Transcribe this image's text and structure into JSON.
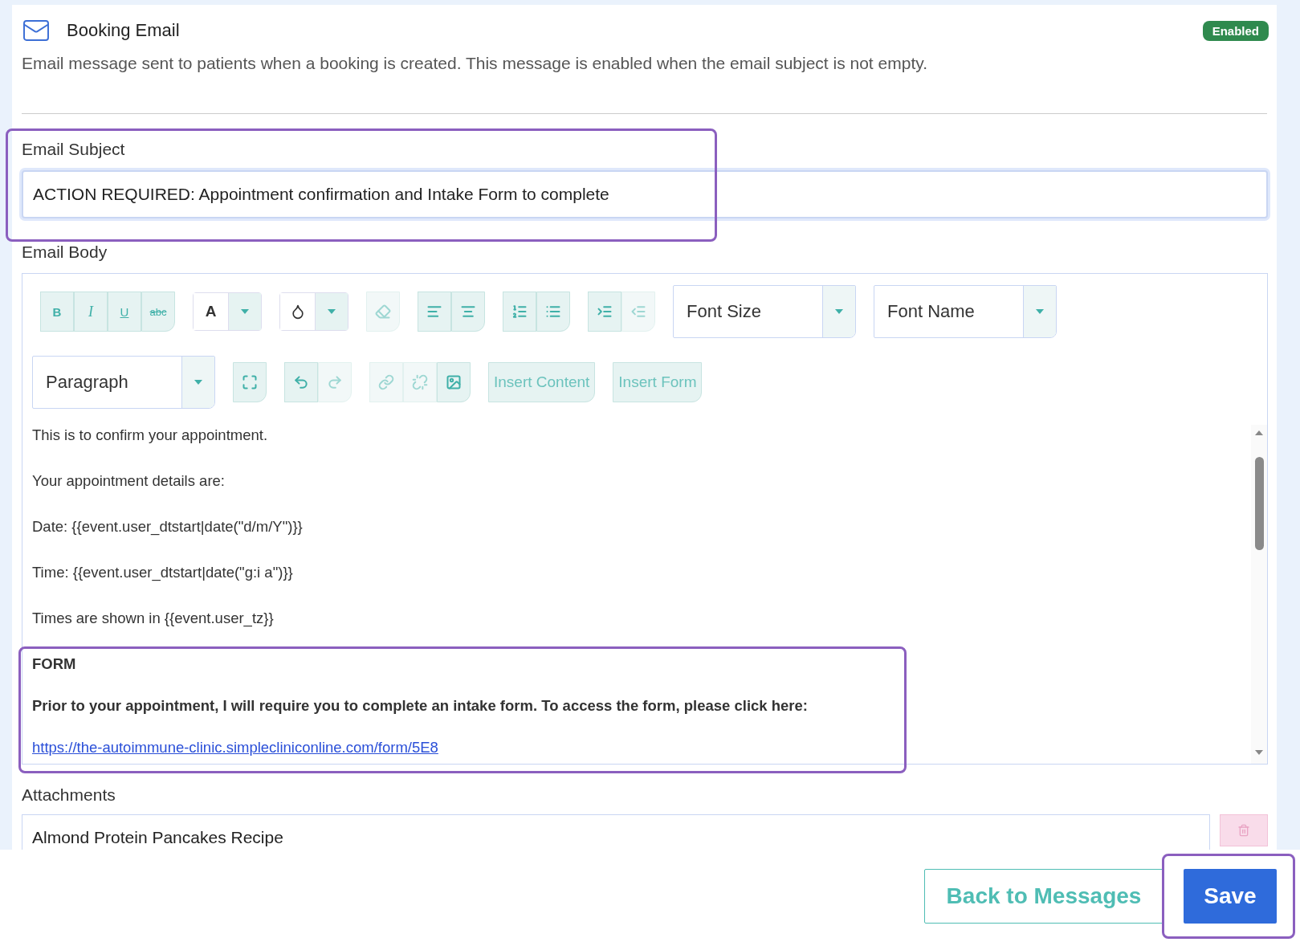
{
  "header": {
    "title": "Booking Email",
    "status": {
      "label": "Enabled",
      "enabled": true
    },
    "description": "Email message sent to patients when a booking is created. This message is enabled when the email subject is not empty."
  },
  "subject": {
    "label": "Email Subject",
    "value": "ACTION REQUIRED: Appointment confirmation and Intake Form to complete"
  },
  "body": {
    "label": "Email Body",
    "toolbar": [
      [
        {
          "kind": "group",
          "items": [
            {
              "label": "B",
              "disabled": false
            },
            {
              "label": "I",
              "disabled": false
            },
            {
              "label": "U",
              "disabled": false
            },
            {
              "label": "abc",
              "disabled": false
            }
          ]
        },
        {
          "kind": "color",
          "label": "A"
        },
        {
          "kind": "color"
        },
        {
          "kind": "group",
          "items": [
            {
              "disabled": true
            }
          ]
        },
        {
          "kind": "group",
          "items": [
            {
              "disabled": false
            },
            {
              "disabled": false
            }
          ]
        },
        {
          "kind": "group",
          "items": [
            {
              "disabled": false
            },
            {
              "disabled": false
            }
          ]
        },
        {
          "kind": "group",
          "items": [
            {
              "disabled": false
            },
            {
              "disabled": true
            }
          ]
        },
        {
          "kind": "select",
          "label": "Font Size"
        },
        {
          "kind": "select",
          "label": "Font Name"
        }
      ],
      [
        {
          "kind": "select",
          "label": "Paragraph"
        },
        {
          "kind": "group",
          "items": [
            {
              "disabled": false
            }
          ]
        },
        {
          "kind": "group",
          "items": [
            {
              "disabled": false
            },
            {
              "disabled": true
            }
          ]
        },
        {
          "kind": "group",
          "items": [
            {
              "disabled": true
            },
            {
              "disabled": true
            },
            {
              "disabled": false
            }
          ]
        },
        {
          "kind": "text_button",
          "label": "Insert Content"
        },
        {
          "kind": "text_button",
          "label": "Insert Form"
        }
      ]
    ],
    "paragraphs": [
      {
        "kind": "text",
        "text": "This is to confirm your appointment."
      },
      {
        "kind": "text",
        "text": "Your appointment details are:"
      },
      {
        "kind": "text",
        "text": "Date: {{event.user_dtstart|date(\"d/m/Y\")}}"
      },
      {
        "kind": "text",
        "text": "Time: {{event.user_dtstart|date(\"g:i a\")}}"
      },
      {
        "kind": "text",
        "text": "Times are shown in  {{event.user_tz}}"
      },
      {
        "kind": "bold",
        "text": "FORM"
      },
      {
        "kind": "bold",
        "text": "Prior to your appointment, I will require you to complete an intake form. To access the form, please click here:"
      },
      {
        "kind": "link",
        "text": "https://the-autoimmune-clinic.simplecliniconline.com/form/5E8"
      }
    ]
  },
  "attachments": {
    "label": "Attachments",
    "items": [
      {
        "name": "Almond Protein Pancakes Recipe"
      }
    ]
  },
  "footer": {
    "buttons": [
      {
        "label": "Back to Messages",
        "kind": "secondary"
      },
      {
        "label": "Save",
        "kind": "primary"
      }
    ]
  }
}
